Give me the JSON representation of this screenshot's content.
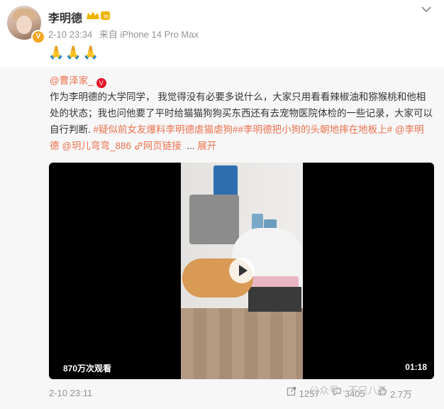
{
  "post": {
    "author": "李明德",
    "time": "2-10 23:34",
    "source": "来自 iPhone 14 Pro Max",
    "text": "🙏🙏🙏"
  },
  "quoted": {
    "author": "@曹泽家_",
    "text_main": "作为李明德的大学同学， 我觉得没有必要多说什么，大家只用看看辣椒油和猕猴桃和他相处的状态；我也问他要了平时给猫猫狗狗买东西还有去宠物医院体检的一些记录，大家可以自行判断.",
    "hashtag1": "#疑似前女友爆料李明德虐猫虐狗#",
    "hashtag2": "#李明德把小狗的头朝地摔在地板上#",
    "mention1": "@李明德",
    "mention2": "@玥儿弯弯_886",
    "web_link": "网页链接",
    "expand": "展开",
    "video": {
      "views": "870万次观看",
      "duration": "01:18"
    },
    "time": "2-10 23:11",
    "reposts": "1257",
    "comments": "3405",
    "likes": "2.7万"
  },
  "watermark": "公众号 · 不只八卦",
  "colors": {
    "link": "#eb7350",
    "meta": "#939393",
    "quoted_bg": "#f7f7f7"
  }
}
